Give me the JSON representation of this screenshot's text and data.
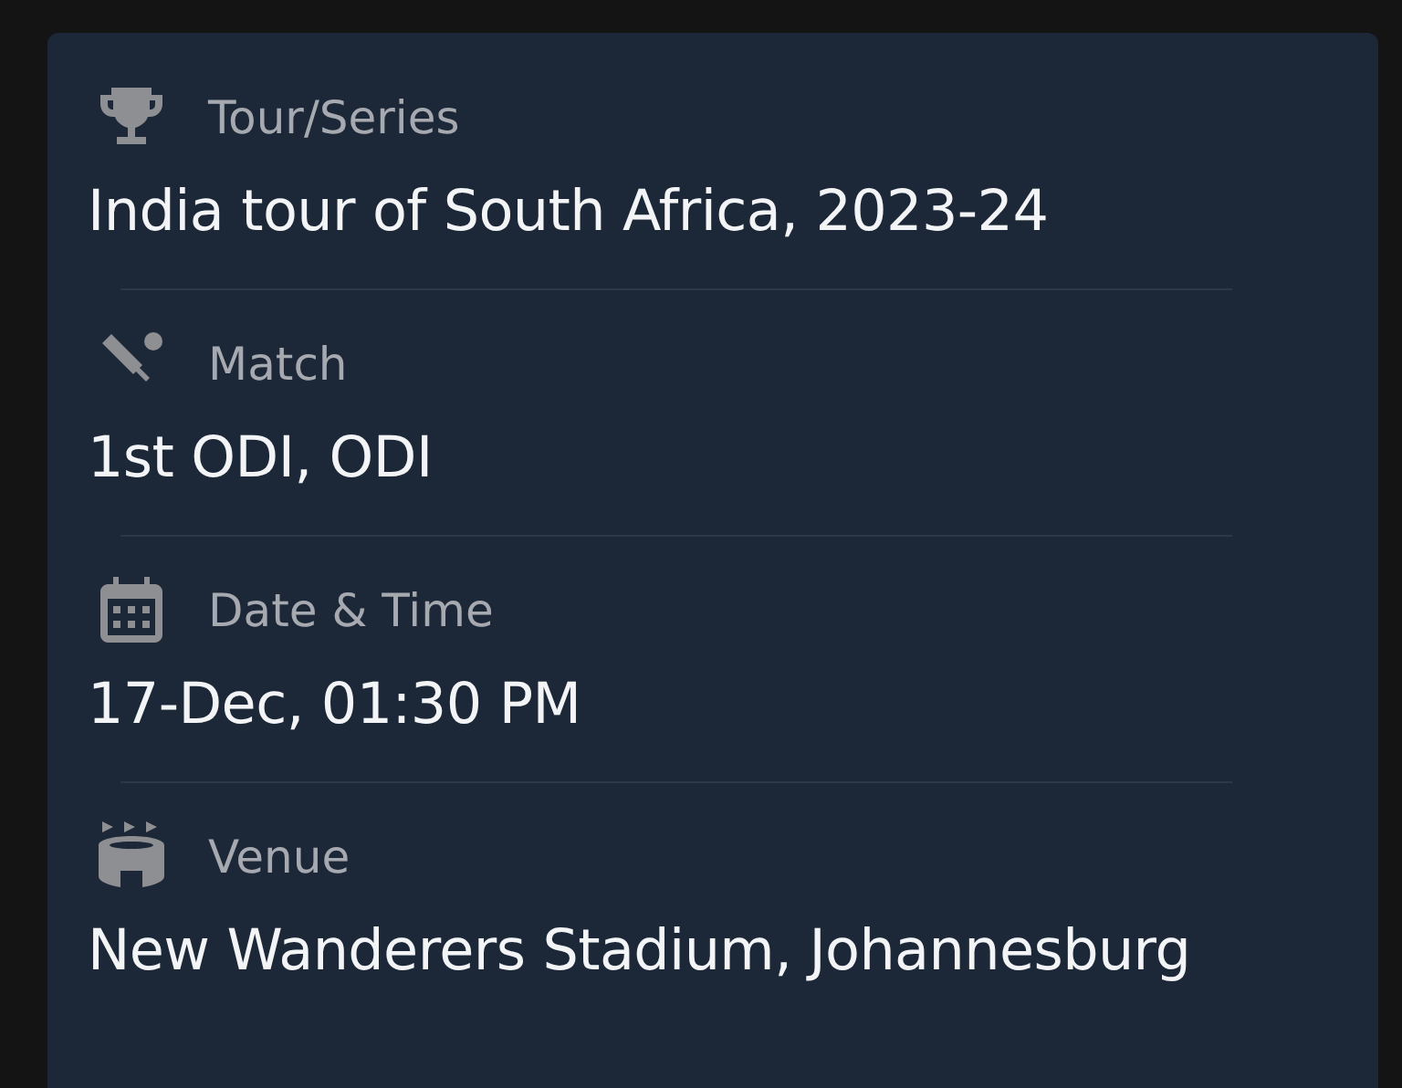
{
  "details": [
    {
      "kind": "trophy",
      "label": "Tour/Series",
      "value": "India tour of South Africa, 2023-24"
    },
    {
      "kind": "cricket",
      "label": "Match",
      "value": "1st ODI, ODI"
    },
    {
      "kind": "calendar",
      "label": "Date & Time",
      "value": "17-Dec, 01:30 PM"
    },
    {
      "kind": "stadium",
      "label": "Venue",
      "value": "New Wanderers Stadium, Johannesburg"
    }
  ]
}
